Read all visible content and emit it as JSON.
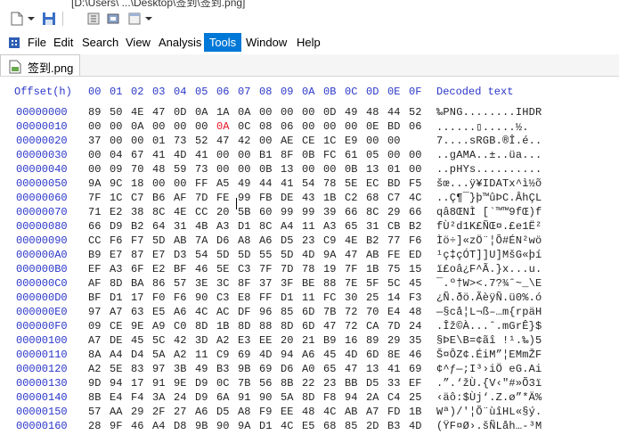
{
  "window": {
    "path": "[D:\\Users\\ ...\\Desktop\\签到\\签到.png]",
    "toolbar_icons": [
      "file-icon",
      "dropdown-icon",
      "new-icon",
      "save-icon",
      "options-icon",
      "settings-icon",
      "window-icon",
      "dropdown-icon"
    ]
  },
  "menu": {
    "items": [
      "File",
      "Edit",
      "Search",
      "View",
      "Analysis",
      "Tools",
      "Window",
      "Help"
    ],
    "active": "Tools"
  },
  "tab": {
    "label": "签到.png"
  },
  "header": {
    "offset": "Offset(h)",
    "columns": [
      "00",
      "01",
      "02",
      "03",
      "04",
      "05",
      "06",
      "07",
      "08",
      "09",
      "0A",
      "0B",
      "0C",
      "0D",
      "0E",
      "0F"
    ],
    "decoded": "Decoded text"
  },
  "rows": [
    {
      "off": "00000000",
      "b": [
        "89",
        "50",
        "4E",
        "47",
        "0D",
        "0A",
        "1A",
        "0A",
        "00",
        "00",
        "00",
        "0D",
        "49",
        "48",
        "44",
        "52"
      ],
      "t": "‰PNG........IHDR"
    },
    {
      "off": "00000010",
      "b": [
        "00",
        "00",
        "0A",
        "00",
        "00",
        "00",
        "0A",
        "0C",
        "08",
        "06",
        "00",
        "00",
        "00",
        "0E",
        "BD",
        "06"
      ],
      "t": "......▯.....½."
    },
    {
      "off": "00000020",
      "b": [
        "37",
        "00",
        "00",
        "01",
        "73",
        "52",
        "47",
        "42",
        "00",
        "AE",
        "CE",
        "1C",
        "E9",
        "00",
        "00"
      ],
      "t": "7....sRGB.®Î.é.."
    },
    {
      "off": "00000030",
      "b": [
        "00",
        "04",
        "67",
        "41",
        "4D",
        "41",
        "00",
        "00",
        "B1",
        "8F",
        "0B",
        "FC",
        "61",
        "05",
        "00",
        "00"
      ],
      "t": "..gAMA..±..üa..."
    },
    {
      "off": "00000040",
      "b": [
        "00",
        "09",
        "70",
        "48",
        "59",
        "73",
        "00",
        "00",
        "0B",
        "13",
        "00",
        "00",
        "0B",
        "13",
        "01",
        "00"
      ],
      "t": "..pHYs.........."
    },
    {
      "off": "00000050",
      "b": [
        "9A",
        "9C",
        "18",
        "00",
        "00",
        "FF",
        "A5",
        "49",
        "44",
        "41",
        "54",
        "78",
        "5E",
        "EC",
        "BD",
        "F5"
      ],
      "t": "šœ...ÿ¥IDATx^ì½õ"
    },
    {
      "off": "00000060",
      "b": [
        "7F",
        "1C",
        "C7",
        "B6",
        "AF",
        "7D",
        "FE",
        "99",
        "FB",
        "DE",
        "43",
        "1B",
        "C2",
        "68",
        "C7",
        "4C"
      ],
      "t": "..Ç¶¯}þ™ûÞC.ÂhÇL"
    },
    {
      "off": "00000070",
      "b": [
        "71",
        "E2",
        "38",
        "8C",
        "4E",
        "CC",
        "20",
        "5B",
        "60",
        "99",
        "99",
        "39",
        "66",
        "8C",
        "29",
        "66"
      ],
      "t": "qâ8ŒNÌ [`™™9fŒ)f"
    },
    {
      "off": "00000080",
      "b": [
        "66",
        "D9",
        "B2",
        "64",
        "31",
        "4B",
        "A3",
        "D1",
        "8C",
        "A4",
        "11",
        "A3",
        "65",
        "31",
        "CB",
        "B2"
      ],
      "t": "fÙ²d1K£ÑŒ¤.£e1Ë²"
    },
    {
      "off": "00000090",
      "b": [
        "CC",
        "F6",
        "F7",
        "5D",
        "AB",
        "7A",
        "D6",
        "A8",
        "A6",
        "D5",
        "23",
        "C9",
        "4E",
        "B2",
        "77",
        "F6"
      ],
      "t": "Ìö÷]«zÖ¨¦Õ#ÉN²wö"
    },
    {
      "off": "000000A0",
      "b": [
        "B9",
        "E7",
        "87",
        "E7",
        "D3",
        "54",
        "5D",
        "5D",
        "55",
        "5D",
        "4D",
        "9A",
        "47",
        "AB",
        "FE",
        "ED"
      ],
      "t": "¹ç‡çÓT]]U]MšG«þí"
    },
    {
      "off": "000000B0",
      "b": [
        "EF",
        "A3",
        "6F",
        "E2",
        "BF",
        "46",
        "5E",
        "C3",
        "7F",
        "7D",
        "78",
        "19",
        "7F",
        "1B",
        "75",
        "15"
      ],
      "t": "ï£oâ¿F^Ã.}x...u."
    },
    {
      "off": "000000C0",
      "b": [
        "AF",
        "8D",
        "BA",
        "86",
        "57",
        "3E",
        "3C",
        "8F",
        "37",
        "3F",
        "BE",
        "88",
        "7E",
        "5F",
        "5C",
        "45"
      ],
      "t": "¯.º†W><.7?¾ˆ~_\\E"
    },
    {
      "off": "000000D0",
      "b": [
        "BF",
        "D1",
        "17",
        "F0",
        "F6",
        "90",
        "C3",
        "E8",
        "FF",
        "D1",
        "11",
        "FC",
        "30",
        "25",
        "14",
        "F3"
      ],
      "t": "¿Ñ.ðö.ÃèÿÑ.ü0%.ó"
    },
    {
      "off": "000000E0",
      "b": [
        "97",
        "A7",
        "63",
        "E5",
        "A6",
        "4C",
        "AC",
        "DF",
        "96",
        "85",
        "6D",
        "7B",
        "72",
        "70",
        "E4",
        "48"
      ],
      "t": "—§cå¦L¬ß–…m{rpäH"
    },
    {
      "off": "000000F0",
      "b": [
        "09",
        "CE",
        "9E",
        "A9",
        "C0",
        "8D",
        "1B",
        "8D",
        "88",
        "8D",
        "6D",
        "47",
        "72",
        "CA",
        "7D",
        "24"
      ],
      "t": ".Îž©À...ˆ.mGrÊ}$"
    },
    {
      "off": "00000100",
      "b": [
        "A7",
        "DE",
        "45",
        "5C",
        "42",
        "3D",
        "A2",
        "E3",
        "EE",
        "20",
        "21",
        "B9",
        "16",
        "89",
        "29",
        "35"
      ],
      "t": "§ÞE\\B=¢ãî !¹.‰)5"
    },
    {
      "off": "00000110",
      "b": [
        "8A",
        "A4",
        "D4",
        "5A",
        "A2",
        "11",
        "C9",
        "69",
        "4D",
        "94",
        "A6",
        "45",
        "4D",
        "6D",
        "8E",
        "46"
      ],
      "t": "Š¤ÔZ¢.ÉiM”¦EMmŽF"
    },
    {
      "off": "00000120",
      "b": [
        "A2",
        "5E",
        "83",
        "97",
        "3B",
        "49",
        "B3",
        "9B",
        "69",
        "D6",
        "A0",
        "65",
        "47",
        "13",
        "41",
        "69"
      ],
      "t": "¢^ƒ—;I³›iÖ eG.Ai"
    },
    {
      "off": "00000130",
      "b": [
        "9D",
        "94",
        "17",
        "91",
        "9E",
        "D9",
        "0C",
        "7B",
        "56",
        "8B",
        "22",
        "23",
        "BB",
        "D5",
        "33",
        "EF"
      ],
      "t": ".”.‘žÙ.{V‹\"#»Õ3ï"
    },
    {
      "off": "00000140",
      "b": [
        "8B",
        "E4",
        "F4",
        "3A",
        "24",
        "D9",
        "6A",
        "91",
        "90",
        "5A",
        "8D",
        "F8",
        "94",
        "2A",
        "C4",
        "25"
      ],
      "t": "‹äô:$Ùj‘.Z.ø”*Ä%"
    },
    {
      "off": "00000150",
      "b": [
        "57",
        "AA",
        "29",
        "2F",
        "27",
        "A6",
        "D5",
        "A8",
        "F9",
        "EE",
        "48",
        "4C",
        "AB",
        "A7",
        "FD",
        "1B"
      ],
      "t": "Wª)/'¦Õ¨ùîHL«§ý."
    },
    {
      "off": "00000160",
      "b": [
        "28",
        "9F",
        "46",
        "A4",
        "D8",
        "9B",
        "90",
        "9A",
        "D1",
        "4C",
        "E5",
        "68",
        "85",
        "2D",
        "B3",
        "4D"
      ],
      "t": "(ŸF¤Ø›.šÑLåh…-³M"
    }
  ],
  "modified_cells": [
    [
      1,
      6
    ]
  ],
  "caret_cell": [
    1,
    7
  ]
}
